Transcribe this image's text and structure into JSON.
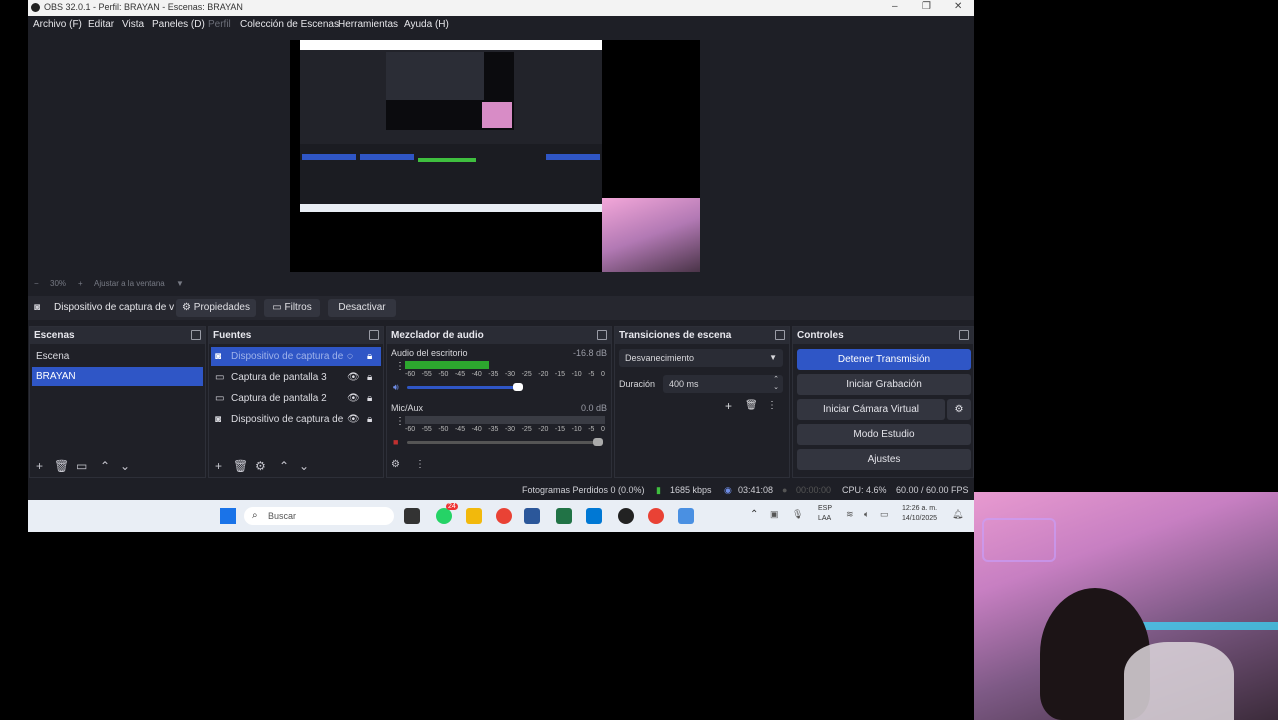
{
  "window": {
    "title": "OBS 32.0.1 - Perfil: BRAYAN - Escenas: BRAYAN"
  },
  "menubar": {
    "items": [
      "Archivo (F)",
      "Editar",
      "Vista",
      "Paneles (D)",
      "Perfil",
      "Colección de Escenas",
      "Herramientas",
      "Ayuda (H)"
    ]
  },
  "preview": {
    "zoom": "30%",
    "fit": "Ajustar a la ventana"
  },
  "source_toolbar": {
    "source_name": "Dispositivo de captura de v",
    "properties": "Propiedades",
    "filters": "Filtros",
    "deactivate": "Desactivar"
  },
  "scenes": {
    "title": "Escenas",
    "items": [
      "Escena",
      "BRAYAN"
    ],
    "selected": "BRAYAN"
  },
  "sources": {
    "title": "Fuentes",
    "items": [
      {
        "name": "Dispositivo de captura de v",
        "selected": true
      },
      {
        "name": "Captura de pantalla 3",
        "selected": false
      },
      {
        "name": "Captura de pantalla 2",
        "selected": false
      },
      {
        "name": "Dispositivo de captura de v",
        "selected": false
      }
    ]
  },
  "mixer": {
    "title": "Mezclador de audio",
    "channels": [
      {
        "name": "Audio del escritorio",
        "db": "-16.8 dB",
        "level": 0.42
      },
      {
        "name": "Mic/Aux",
        "db": "0.0 dB",
        "level": 0.0
      }
    ],
    "ticks": [
      "-60",
      "-55",
      "-50",
      "-45",
      "-40",
      "-35",
      "-30",
      "-25",
      "-20",
      "-15",
      "-10",
      "-5",
      "0"
    ]
  },
  "transitions": {
    "title": "Transiciones de escena",
    "selected": "Desvanecimiento",
    "duration_label": "Duración",
    "duration_value": "400 ms"
  },
  "controls": {
    "title": "Controles",
    "stop_stream": "Detener Transmisión",
    "start_record": "Iniciar Grabación",
    "virtual_cam": "Iniciar Cámara Virtual",
    "studio_mode": "Modo Estudio",
    "settings": "Ajustes"
  },
  "status": {
    "dropped": "Fotogramas Perdidos 0 (0.0%)",
    "bitrate": "1685 kbps",
    "live_time": "03:41:08",
    "rec_time": "00:00:00",
    "cpu": "CPU: 4.6%",
    "fps": "60.00 / 60.00 FPS"
  },
  "taskbar": {
    "search_placeholder": "Buscar",
    "lang": "ESP",
    "lang2": "LAA",
    "time": "12:26 a. m.",
    "date": "14/10/2025",
    "badge": "24"
  },
  "colors": {
    "accent": "#2f56c6",
    "bg": "#1e1f26"
  }
}
